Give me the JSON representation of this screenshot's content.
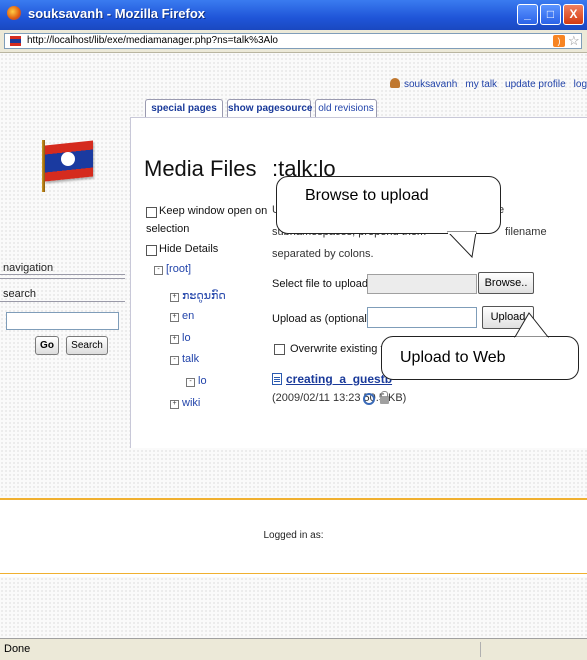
{
  "window": {
    "title": "souksavanh - Mozilla Firefox",
    "controls": {
      "minimize": "_",
      "maximize": "□",
      "close": "X"
    }
  },
  "address_bar": {
    "url": "http://localhost/lib/exe/mediamanager.php?ns=talk%3Alo"
  },
  "user_bar": {
    "user": "souksavanh",
    "links": [
      "my talk",
      "update profile",
      "logout"
    ]
  },
  "tabs": [
    "special pages",
    "show pagesource",
    "old revisions"
  ],
  "sidebar": {
    "navigation_label": "navigation",
    "search_label": "search",
    "search_value": "",
    "go_label": "Go",
    "search_button": "Search"
  },
  "media": {
    "title": "Media Files",
    "namespace": ":talk:lo",
    "keep_open_line1": "Keep window open on",
    "keep_open_line2": "selection",
    "hide_details": "Hide Details",
    "tree": {
      "root": "[root]",
      "lao": "ກະດູນກົດ",
      "en": "en",
      "lo": "lo",
      "talk": "talk",
      "talk_lo": "lo",
      "wiki": "wiki"
    },
    "toggles": {
      "expand": "+",
      "collapse": "-"
    },
    "intro_a": "U",
    "intro_e": "e",
    "intro_b": "subnamespaces, prepend them",
    "intro_d": "filename",
    "intro_c": "separated by colons.",
    "select_label": "Select file to upload:",
    "browse_label": "Browse..",
    "upload_as_label": "Upload as (optional):",
    "upload_label": "Upload",
    "overwrite_label": "Overwrite existing f",
    "file_name": "creating_a_guestb",
    "file_meta": "(2009/02/11 13:23 50.5 KB)"
  },
  "callouts": {
    "browse": "Browse to upload",
    "upload": "Upload to Web"
  },
  "footer": {
    "logged_in": "Logged in as:"
  },
  "status": {
    "text": "Done"
  },
  "colors": {
    "titlebar": "#1f55d8",
    "link": "#2244aa",
    "separator": "#f0b030"
  },
  "icons": [
    "firefox-icon",
    "site-flag-icon",
    "rss-icon",
    "bookmark-star-icon",
    "user-icon",
    "file-icon",
    "magnifier-icon",
    "lock-icon"
  ]
}
